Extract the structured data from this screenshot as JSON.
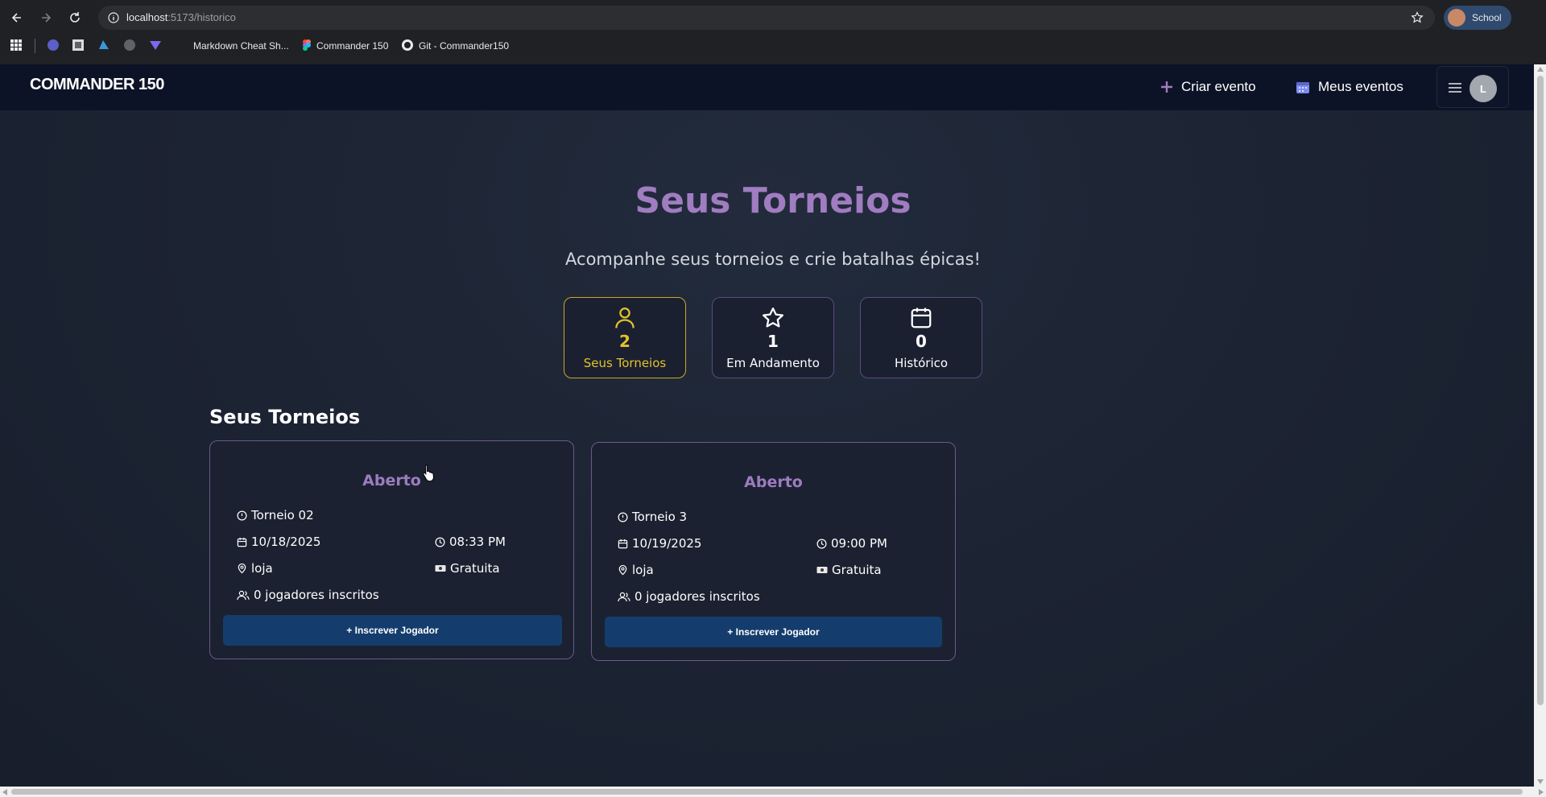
{
  "browser": {
    "url_host": "localhost",
    "url_path": ":5173/historico",
    "profile_name": "School",
    "bookmarks": [
      "Markdown Cheat Sh...",
      "Commander 150",
      "Git - Commander150"
    ]
  },
  "header": {
    "logo": "COMMANDER 150",
    "create_event": "Criar evento",
    "my_events": "Meus eventos",
    "avatar_initial": "L"
  },
  "hero": {
    "title": "Seus Torneios",
    "subtitle": "Acompanhe seus torneios e crie batalhas épicas!"
  },
  "stats": [
    {
      "value": "2",
      "label": "Seus Torneios",
      "icon": "user-icon"
    },
    {
      "value": "1",
      "label": "Em Andamento",
      "icon": "star-icon"
    },
    {
      "value": "0",
      "label": "Histórico",
      "icon": "calendar-icon"
    }
  ],
  "section_title": "Seus Torneios",
  "tournaments": [
    {
      "status": "Aberto",
      "name": "Torneio 02",
      "date": "10/18/2025",
      "time": "08:33 PM",
      "location": "loja",
      "price": "Gratuita",
      "players": "0 jogadores inscritos",
      "button": "+ Inscrever Jogador"
    },
    {
      "status": "Aberto",
      "name": "Torneio 3",
      "date": "10/19/2025",
      "time": "09:00 PM",
      "location": "loja",
      "price": "Gratuita",
      "players": "0 jogadores inscritos",
      "button": "+ Inscrever Jogador"
    }
  ],
  "colors": {
    "accent": "#a07cc0",
    "highlight": "#e2c22a",
    "button": "#143d6e",
    "header_bg": "#0d1326"
  }
}
